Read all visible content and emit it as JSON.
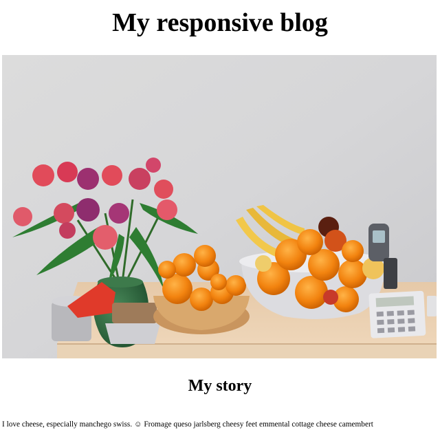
{
  "page": {
    "title": "My responsive blog"
  },
  "hero_image": {
    "subject": "still-life-photo-flowers-and-fruit-bowls"
  },
  "story": {
    "heading": "My story",
    "text": "I love cheese, especially manchego swiss. ☺ Fromage queso jarlsberg cheesy feet emmental cottage cheese camembert"
  }
}
